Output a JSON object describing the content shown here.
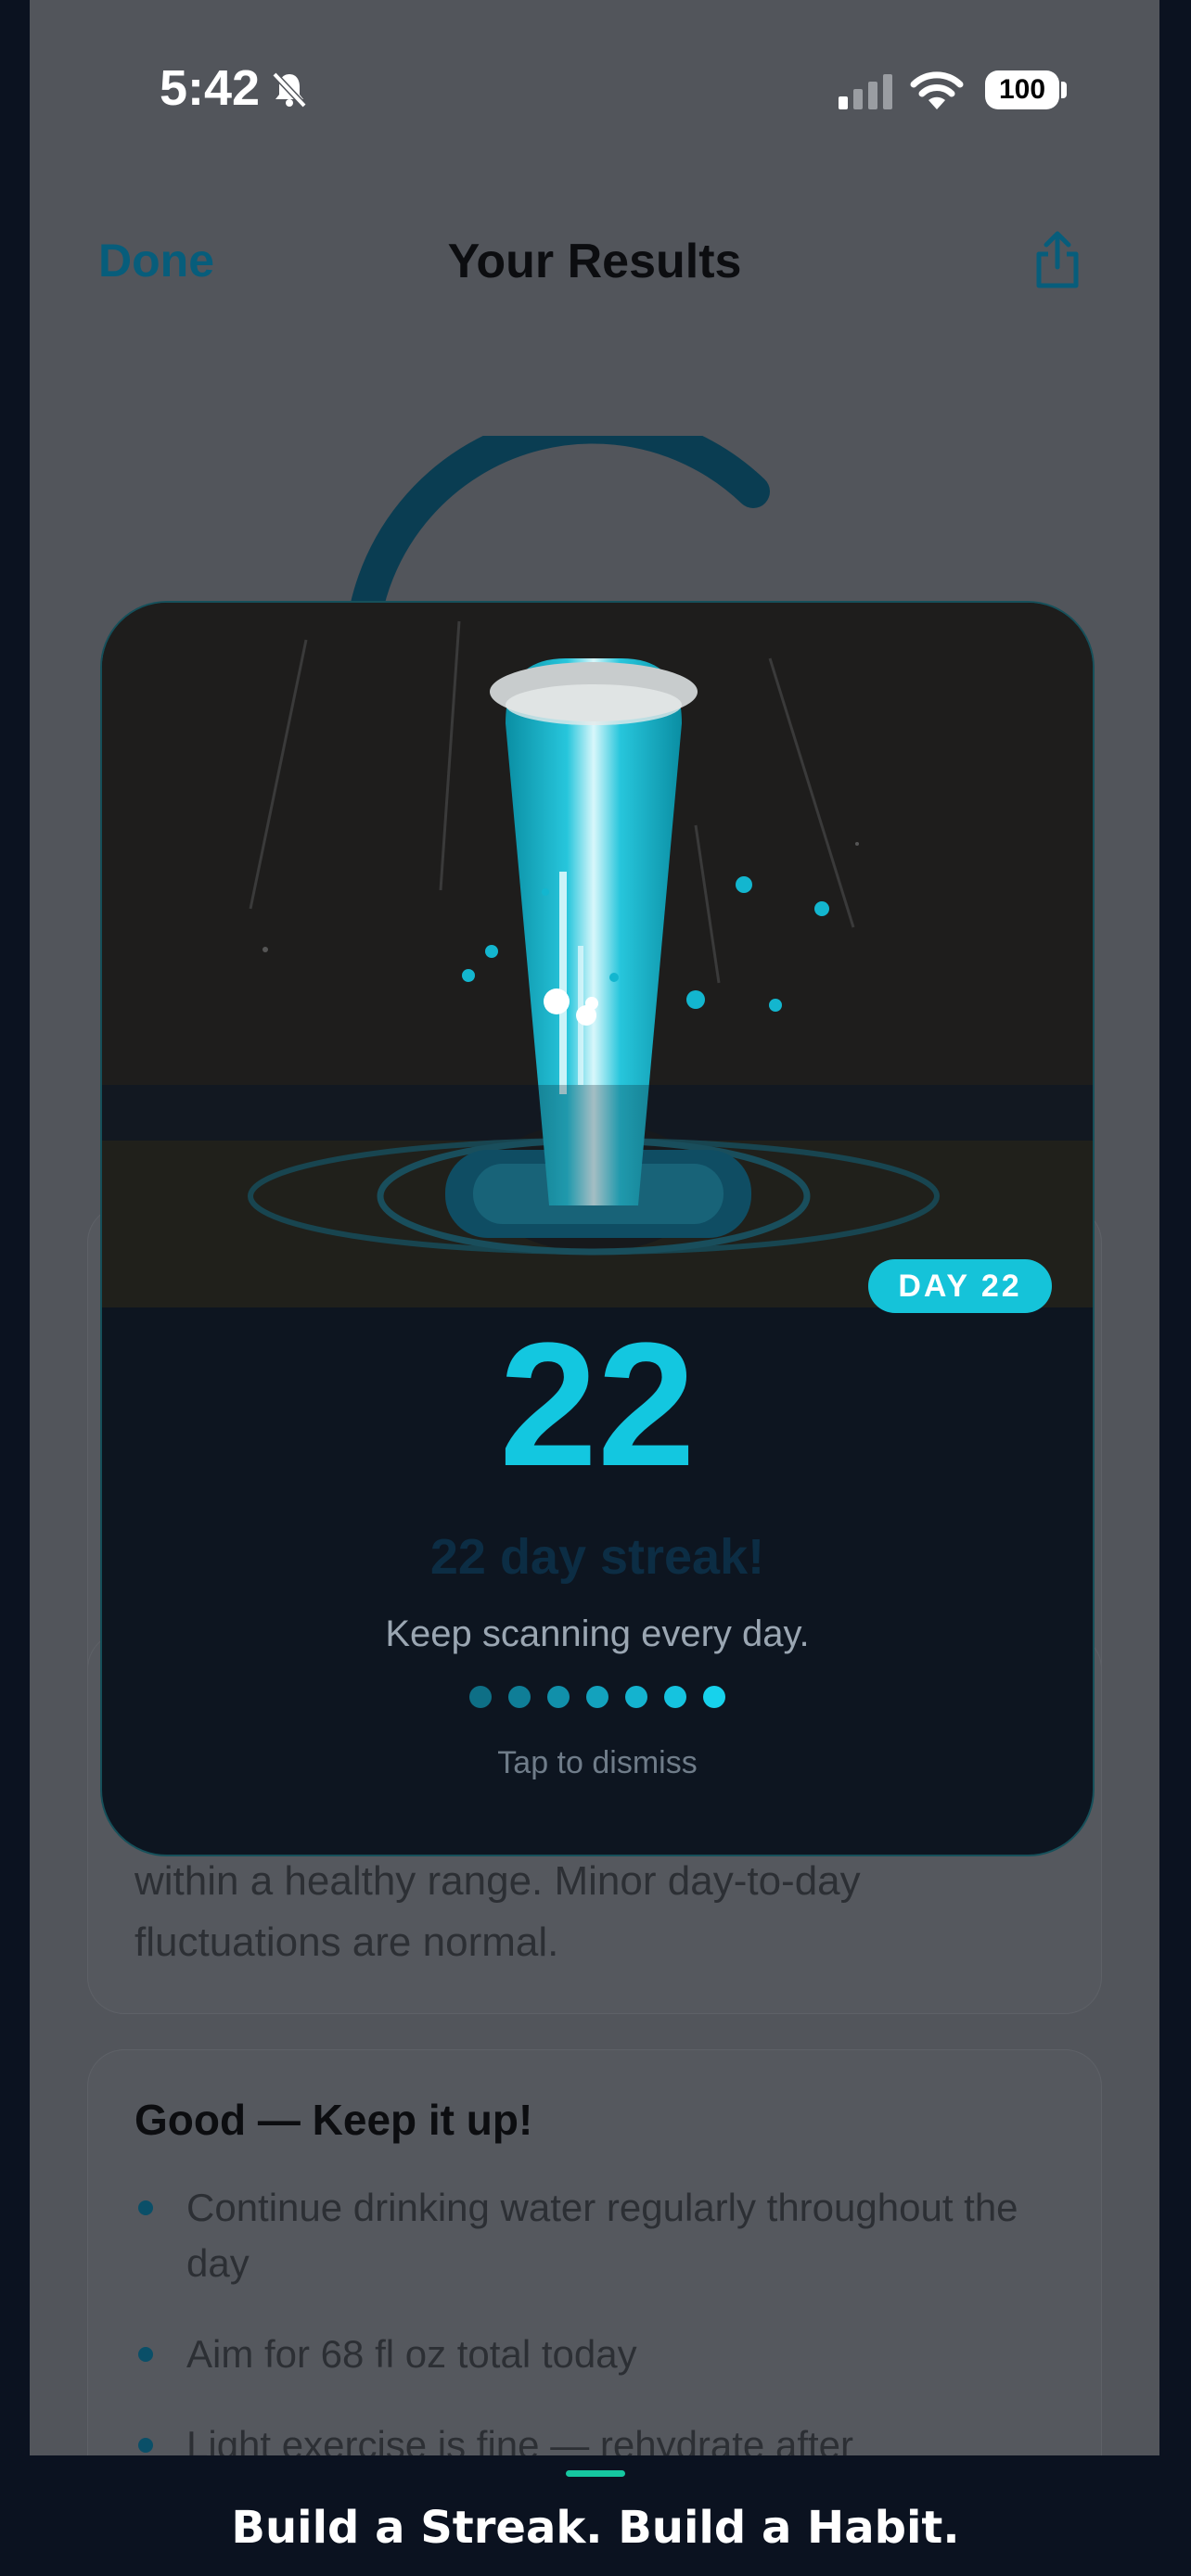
{
  "status_bar": {
    "time": "5:42",
    "battery": "100"
  },
  "nav": {
    "done_label": "Done",
    "title": "Your Results",
    "share_icon": "share-icon"
  },
  "explanation": {
    "text": "within a healthy range. Minor day-to-day fluctuations are normal."
  },
  "advice": {
    "title": "Good — Keep it up!",
    "items": [
      "Continue drinking water regularly throughout the day",
      "Aim for 68 fl oz total today",
      "Light exercise is fine — rehydrate after"
    ]
  },
  "streak_modal": {
    "badge": "DAY 22",
    "count": "22",
    "headline": "22 day streak!",
    "subtitle": "Keep scanning every day.",
    "dismiss": "Tap to dismiss",
    "progress_dots": 7,
    "dot_colors": [
      "#0e6f86",
      "#0f7e97",
      "#1190aa",
      "#13a2bd",
      "#14b3cf",
      "#15c3df",
      "#17d2ec"
    ]
  },
  "caption": {
    "text": "Build a Streak. Build a Habit."
  },
  "colors": {
    "accent": "#13c7e0",
    "link": "#075d7b",
    "caption_accent": "#16c7a0"
  }
}
